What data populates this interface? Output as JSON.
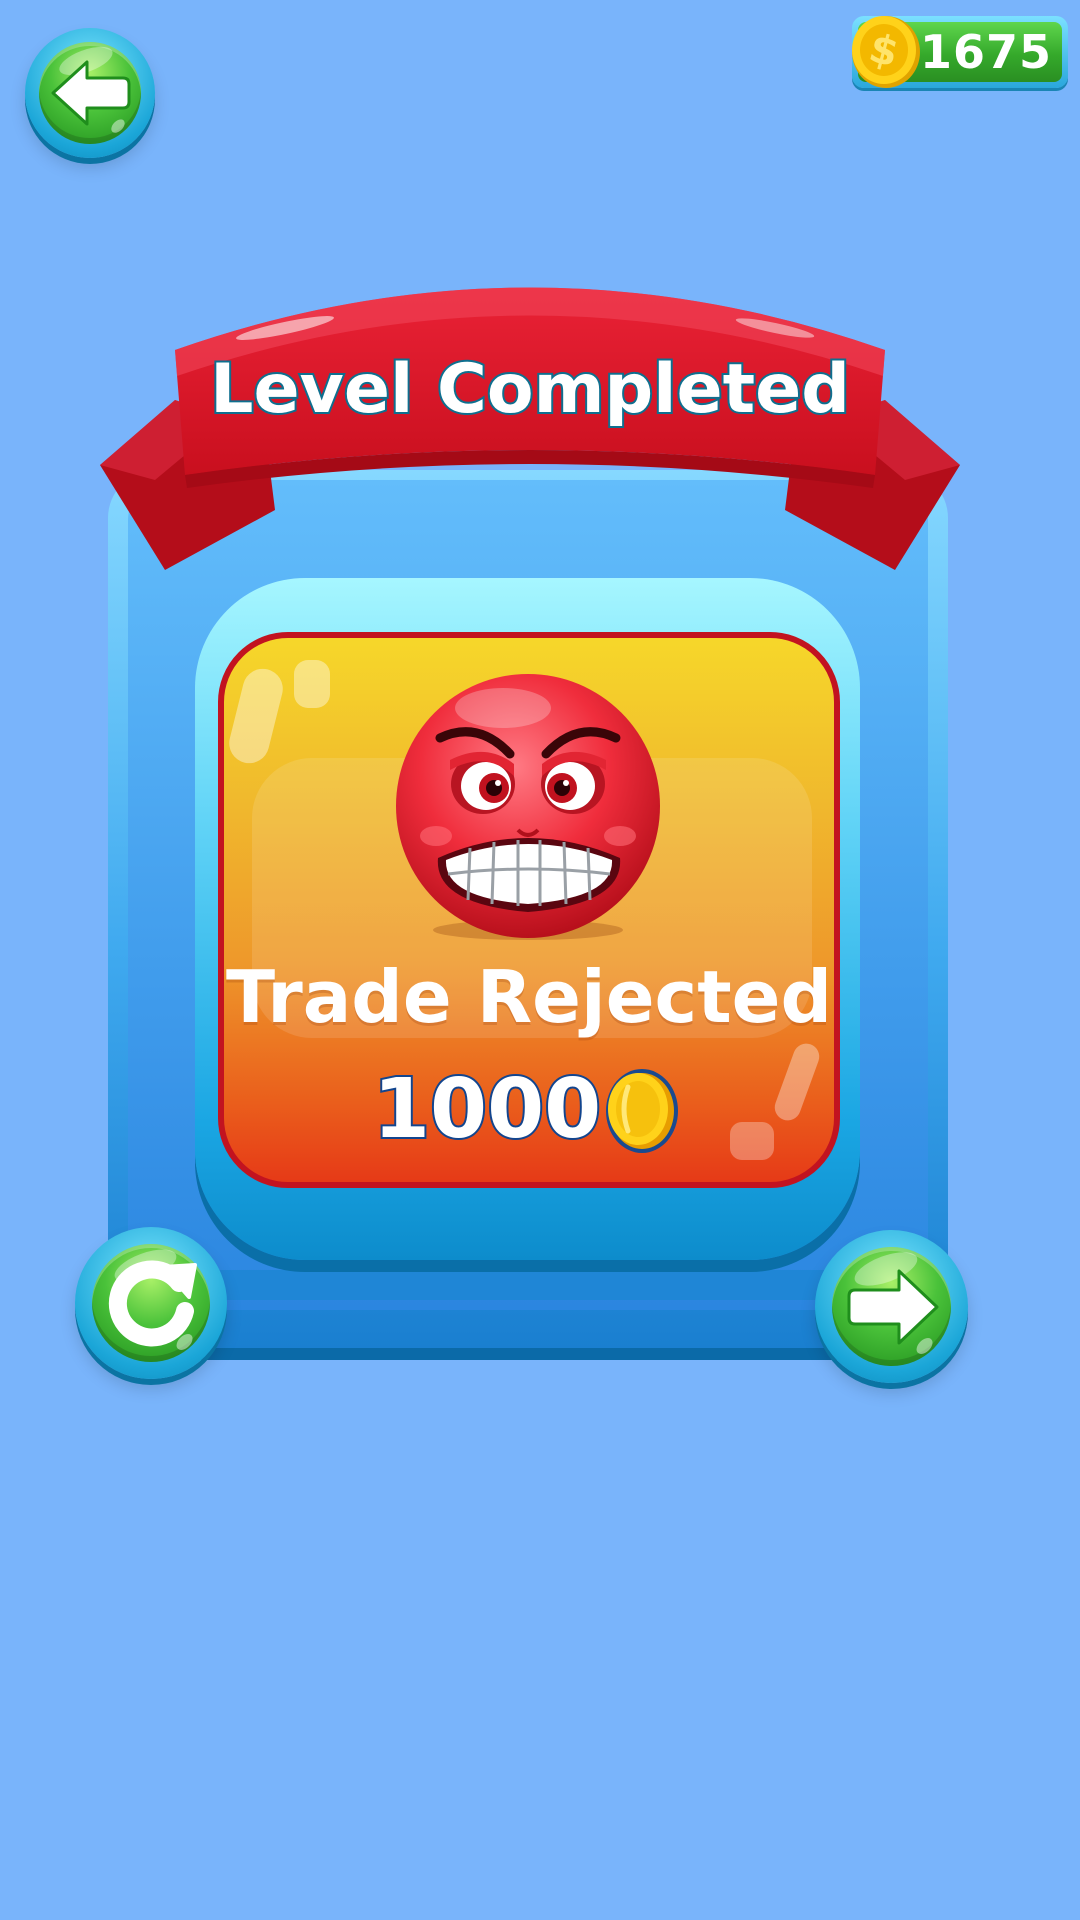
{
  "header": {
    "back_icon": "arrow-left-icon",
    "coin_icon": "dollar-coin-icon",
    "coin_balance": "1675"
  },
  "ribbon": {
    "title": "Level Completed"
  },
  "result": {
    "emoji": "angry-face-icon",
    "title": "Trade Rejected",
    "reward_amount": "1000",
    "reward_icon": "gold-coin-icon"
  },
  "actions": {
    "replay_icon": "restart-icon",
    "next_icon": "arrow-right-icon"
  },
  "colors": {
    "background": "#79b4fb",
    "button_green": "#4ac23a",
    "ribbon_red": "#d8192a",
    "card_orange": "#ee982b"
  }
}
